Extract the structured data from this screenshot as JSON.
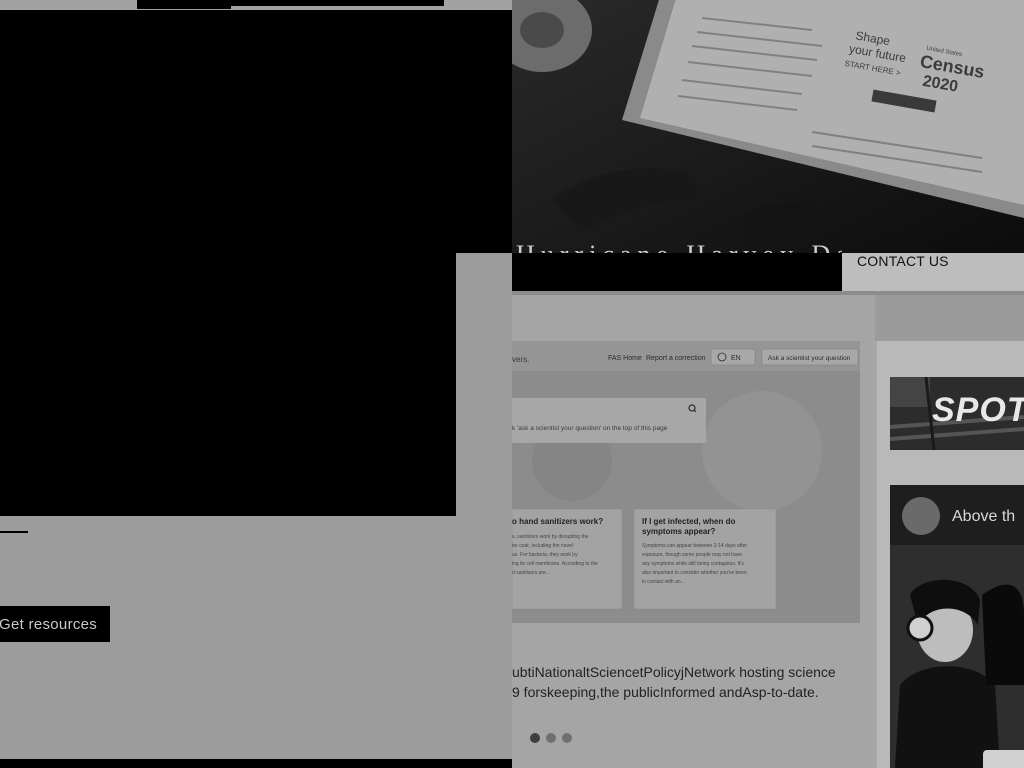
{
  "header": {
    "contact_label": "CONTACT US",
    "hero_caption": "Hurricane Harvey Data and Tools"
  },
  "left_panel": {
    "cta_label": "Get resources"
  },
  "hero": {
    "census_line1": "Shape",
    "census_line2": "your future",
    "census_line3": "START HERE >",
    "census_brand": "United States",
    "census_word": "Census",
    "census_year": "2020"
  },
  "slide": {
    "screenshot": {
      "nav_text": "vers.",
      "fas_home": "FAS Home",
      "report_link": "Report a correction",
      "lang": "EN",
      "ask_button": "Ask a scientist your question",
      "search_hint": "k 'ask a scientist your question' on the top of this page",
      "card1_title": "o hand sanitizers work?",
      "card1_body": "s, sanitizers work by disrupting the ter coat, including the novel us. For bacteria, they work by ing its cell membrane. According to the d sanitizers are...",
      "card2_title": "If I get infected, when do symptoms appear?",
      "card2_body": "Symptoms can appear between 2-14 days after exposure, though some people may not have any symptoms while still being contagious. It's also important to consider whether you've been in contact with an..."
    },
    "caption_line1": "ublished a ... the National Science Policy Network ... hosting science",
    "caption_line2": "9 for keeping the public informed and up-to-date.",
    "caption_line1_exact": "ubtiNationaltSciencetPolicyjNetwork hosting science",
    "caption_line2_exact": "9 forskeeping,the publicInformed andAsp-to-date.",
    "dots": [
      "slide-1",
      "slide-2",
      "slide-3"
    ],
    "active_dot": 0
  },
  "sidebar": {
    "banner_text": "SPOT",
    "video_title": "Above th"
  },
  "colors": {
    "page_bg": "#9b9b9b",
    "black": "#000000",
    "contact_bg": "#bdbdbd",
    "dot_active": "#3e3e3e",
    "dot_inactive": "#6f6f6f"
  }
}
